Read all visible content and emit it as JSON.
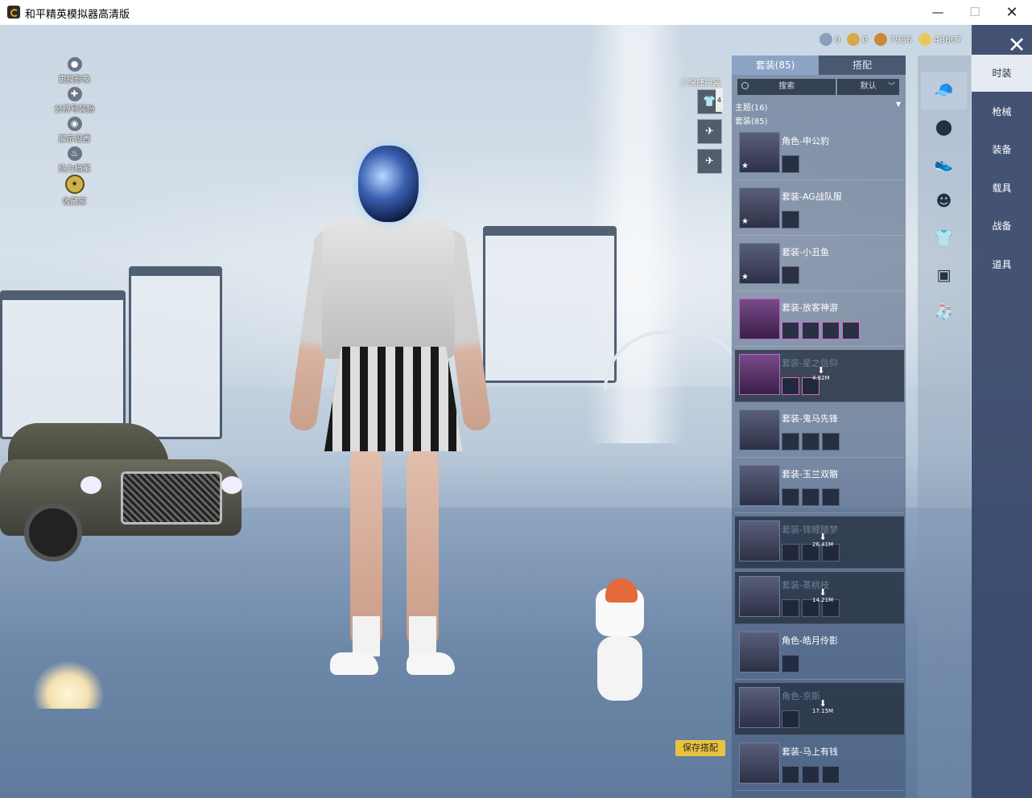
{
  "window": {
    "title": "和平精英模拟器高清版",
    "min_label": "—",
    "max_label": "☐",
    "close_label": "✕"
  },
  "left_menu": [
    {
      "label": "更换形象"
    },
    {
      "label": "分辨号装扮"
    },
    {
      "label": "展示设置"
    },
    {
      "label": "热力档案"
    },
    {
      "label": "收藏家"
    }
  ],
  "currency": {
    "items": [
      {
        "value": "0",
        "color": "#8aa0b8"
      },
      {
        "value": "0",
        "color": "#d9a84a"
      },
      {
        "value": "7956",
        "color": "#c98a38"
      },
      {
        "value": "43607",
        "color": "#e8c85a"
      }
    ]
  },
  "quick_change": {
    "label": "快捷换装",
    "badge": "4"
  },
  "panel": {
    "tabs": [
      {
        "label": "套装(85)",
        "active": true
      },
      {
        "label": "搭配",
        "active": false
      }
    ],
    "search_placeholder": "搜索",
    "sort_label": "默认",
    "theme_label": "主题(16)",
    "suit_label": "套装(85)"
  },
  "items": [
    {
      "name": "角色-申公豹",
      "star": true,
      "dim": false,
      "purple": false,
      "mini_count": 1,
      "size": ""
    },
    {
      "name": "套装-AG战队服",
      "star": true,
      "dim": false,
      "purple": false,
      "mini_count": 1,
      "size": ""
    },
    {
      "name": "套装-小丑鱼",
      "star": true,
      "dim": false,
      "purple": false,
      "mini_count": 1,
      "size": ""
    },
    {
      "name": "套装-放客神游",
      "star": false,
      "dim": false,
      "purple": true,
      "mini_count": 4,
      "size": ""
    },
    {
      "name": "套装-星之信仰",
      "star": false,
      "dim": true,
      "purple": true,
      "mini_count": 2,
      "size": "4.82M"
    },
    {
      "name": "套装-鬼马先锋",
      "star": false,
      "dim": false,
      "purple": false,
      "mini_count": 3,
      "size": ""
    },
    {
      "name": "套装-玉兰双骼",
      "star": false,
      "dim": false,
      "purple": false,
      "mini_count": 3,
      "size": ""
    },
    {
      "name": "套装-锦鲤踏梦",
      "star": false,
      "dim": true,
      "purple": false,
      "mini_count": 3,
      "size": "26.41M"
    },
    {
      "name": "套装-蒸桃枝",
      "star": false,
      "dim": true,
      "purple": false,
      "mini_count": 3,
      "size": "14.21M"
    },
    {
      "name": "角色-皓月伶影",
      "star": false,
      "dim": false,
      "purple": false,
      "mini_count": 1,
      "size": ""
    },
    {
      "name": "角色-京斯",
      "star": false,
      "dim": true,
      "purple": false,
      "mini_count": 1,
      "size": "17.15M"
    },
    {
      "name": "套装-马上有钱",
      "star": false,
      "dim": false,
      "purple": false,
      "mini_count": 3,
      "size": ""
    }
  ],
  "save_button": "保存搭配",
  "icon_column": [
    {
      "name": "hat-icon",
      "glyph": "🧢",
      "active": true
    },
    {
      "name": "helmet-icon",
      "glyph": "⬤",
      "active": false
    },
    {
      "name": "shoe-icon",
      "glyph": "👟",
      "active": false
    },
    {
      "name": "mask-icon",
      "glyph": "☻",
      "active": false
    },
    {
      "name": "outfit-icon",
      "glyph": "👕",
      "active": false
    },
    {
      "name": "backpack-icon",
      "glyph": "▣",
      "active": false
    },
    {
      "name": "socks-icon",
      "glyph": "🧦",
      "active": false
    }
  ],
  "categories": [
    {
      "label": "时装",
      "active": true
    },
    {
      "label": "枪械",
      "active": false
    },
    {
      "label": "装备",
      "active": false
    },
    {
      "label": "载具",
      "active": false
    },
    {
      "label": "战备",
      "active": false
    },
    {
      "label": "道具",
      "active": false
    }
  ],
  "close_glyph": "✕"
}
